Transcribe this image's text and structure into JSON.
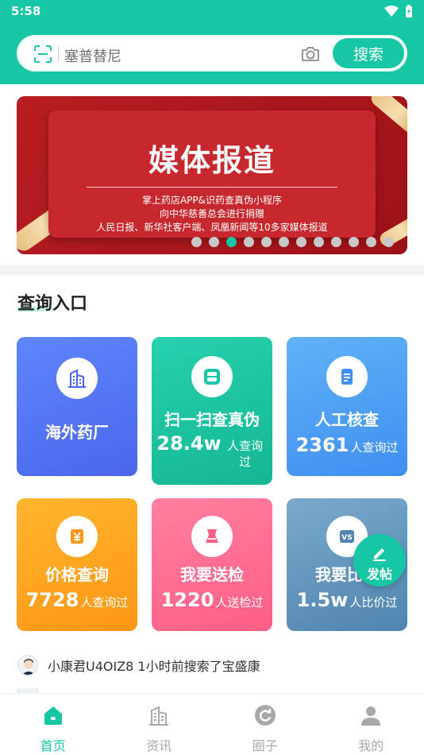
{
  "status_bar": {
    "time": "5:58"
  },
  "search": {
    "placeholder": "塞普替尼",
    "button_label": "搜索"
  },
  "banner": {
    "title": "媒体报道",
    "lines": [
      "掌上药店APP&识药查真伪小程序",
      "向中华慈善总会进行捐赠",
      "人民日报、新华社客户端、凤凰新闻等10多家媒体报道"
    ],
    "dot_count": 12,
    "active_dot": 2
  },
  "section": {
    "title": "查询入口"
  },
  "cards": [
    {
      "title": "海外药厂",
      "icon": "building-icon",
      "count": "",
      "unit": ""
    },
    {
      "title": "扫一扫查真伪",
      "icon": "scan-icon",
      "count": "28.4w",
      "unit": "人查询过"
    },
    {
      "title": "人工核查",
      "icon": "document-icon",
      "count": "2361",
      "unit": "人查询过"
    },
    {
      "title": "价格查询",
      "icon": "yen-icon",
      "count": "7728",
      "unit": "人查询过"
    },
    {
      "title": "我要送检",
      "icon": "flask-icon",
      "count": "1220",
      "unit": "人送检过"
    },
    {
      "title": "我要比价",
      "icon": "vs-icon",
      "count": "1.5w",
      "unit": "人比价过"
    }
  ],
  "fab": {
    "label": "发帖",
    "icon": "pencil-icon"
  },
  "feed": [
    {
      "text": "小康君U4OIZ8 1小时前搜索了宝盛康"
    }
  ],
  "tabs": [
    {
      "label": "首页",
      "icon": "home-icon",
      "active": true
    },
    {
      "label": "资讯",
      "icon": "building-icon",
      "active": false
    },
    {
      "label": "圈子",
      "icon": "refresh-icon",
      "active": false
    },
    {
      "label": "我的",
      "icon": "user-icon",
      "active": false
    }
  ],
  "colors": {
    "brand": "#17c6a4",
    "banner_red": "#c6282d",
    "inactive_tab": "#a8a8a8"
  }
}
